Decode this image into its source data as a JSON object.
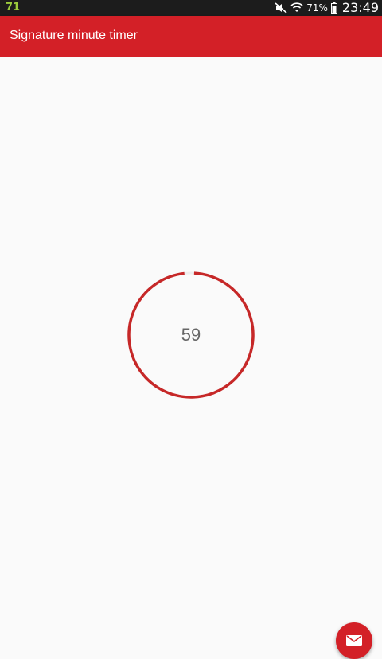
{
  "status_bar": {
    "notification_text": "71",
    "battery_percent": "71%",
    "time": "23:49",
    "icons": [
      "mute-icon",
      "wifi-icon",
      "battery-icon"
    ]
  },
  "app_bar": {
    "title": "Signature minute timer",
    "color": "#d32027"
  },
  "timer": {
    "value": "59",
    "ring_color": "#c62828",
    "progress_fraction": 0.983
  },
  "fab": {
    "icon": "email-icon",
    "color": "#d32027"
  }
}
